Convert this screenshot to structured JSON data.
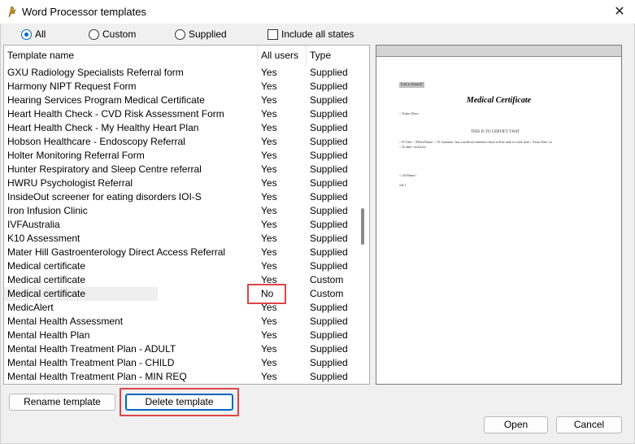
{
  "window": {
    "title": "Word Processor templates",
    "close_glyph": "✕"
  },
  "filters": {
    "all_label": "All",
    "custom_label": "Custom",
    "supplied_label": "Supplied",
    "selected": "All",
    "include_all_states_label": "Include all states",
    "include_all_states_checked": false
  },
  "table": {
    "columns": [
      "Template name",
      "All users",
      "Type"
    ],
    "rows": [
      [
        "GXU Radiology Specialists Referral form",
        "Yes",
        "Supplied"
      ],
      [
        "Harmony NIPT Request Form",
        "Yes",
        "Supplied"
      ],
      [
        "Hearing Services Program Medical Certificate",
        "Yes",
        "Supplied"
      ],
      [
        "Heart Health Check - CVD Risk Assessment Form",
        "Yes",
        "Supplied"
      ],
      [
        "Heart Health Check - My Healthy Heart Plan",
        "Yes",
        "Supplied"
      ],
      [
        "Hobson Healthcare - Endoscopy Referral",
        "Yes",
        "Supplied"
      ],
      [
        "Holter Monitoring Referral Form",
        "Yes",
        "Supplied"
      ],
      [
        "Hunter Respiratory and Sleep Centre referral",
        "Yes",
        "Supplied"
      ],
      [
        "HWRU Psychologist Referral",
        "Yes",
        "Supplied"
      ],
      [
        "InsideOut screener for eating disorders  IOI-S",
        "Yes",
        "Supplied"
      ],
      [
        "Iron Infusion Clinic",
        "Yes",
        "Supplied"
      ],
      [
        "IVFAustralia",
        "Yes",
        "Supplied"
      ],
      [
        "K10 Assessment",
        "Yes",
        "Supplied"
      ],
      [
        "Mater Hill Gastroenterology Direct Access Referral",
        "Yes",
        "Supplied"
      ],
      [
        "Medical certificate",
        "Yes",
        "Supplied"
      ],
      [
        "Medical certificate",
        "Yes",
        "Custom"
      ],
      [
        "Medical certificate",
        "No",
        "Custom"
      ],
      [
        "MedicAlert",
        "Yes",
        "Supplied"
      ],
      [
        "Mental Health Assessment",
        "Yes",
        "Supplied"
      ],
      [
        "Mental Health Plan",
        "Yes",
        "Supplied"
      ],
      [
        "Mental Health Treatment Plan - ADULT",
        "Yes",
        "Supplied"
      ],
      [
        "Mental Health Treatment Plan - CHILD",
        "Yes",
        "Supplied"
      ],
      [
        "Mental Health Treatment Plan - MIN REQ",
        "Yes",
        "Supplied"
      ]
    ],
    "selected_row": 16
  },
  "preview": {
    "logo_text": "Get a closed?",
    "title": "Medical Certificate",
    "line_date": "< Today+Date>",
    "heading": "THIS IS TO CERTIFY THAT",
    "line_body": "< Pt Title> <PtFirstName> < Pt Surname> has a medical condition which will be unfit to work from < From Date>          to",
    "line_body2": "< To date> inclusive.",
    "line_sig": "< GiftName>",
    "line_sig2": "ode 1"
  },
  "buttons": {
    "rename": "Rename template",
    "delete": "Delete template",
    "open": "Open",
    "cancel": "Cancel"
  },
  "colors": {
    "highlight": "#e0444a",
    "accent": "#0067c0"
  }
}
